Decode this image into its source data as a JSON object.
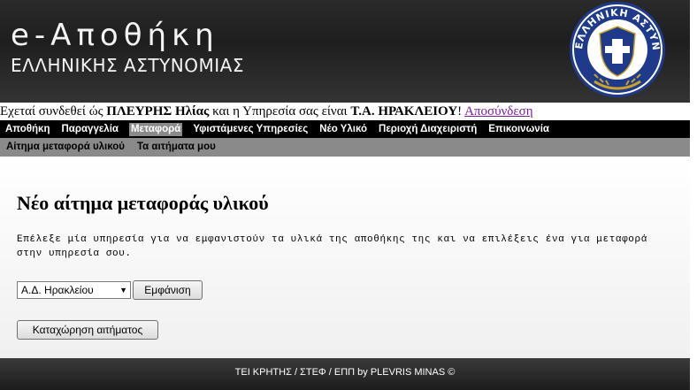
{
  "header": {
    "title": "e-Αποθήκη",
    "subtitle": "ΕΛΛΗΝΙΚΗΣ ΑΣΤΥΝΟΜΙΑΣ",
    "logo_text": "ΕΛΛΗΝΙΚΗ ΑΣΤΥΝΟΜΙΑ"
  },
  "login": {
    "prefix": "Εχεταί συνδεθεί ώς ",
    "user": "ΠΛΕΥΡΗΣ Ηλίας",
    "middle": " και η Υπηρεσία σας είναι ",
    "unit": "Τ.Α. ΗΡΑΚΛΕΙΟΥ",
    "suffix": "! ",
    "logout": "Αποσύνδεση"
  },
  "nav": {
    "items": [
      {
        "label": "Αποθήκη"
      },
      {
        "label": "Παραγγελία"
      },
      {
        "label": "Μεταφορά"
      },
      {
        "label": "Υφιστάμενες Υπηρεσίες"
      },
      {
        "label": "Νέο Υλικό"
      },
      {
        "label": "Περιοχή Διαχειριστή"
      },
      {
        "label": "Επικοινωνία"
      }
    ],
    "active_index": 2
  },
  "subnav": {
    "items": [
      {
        "label": "Αίτημα μεταφορά υλικού"
      },
      {
        "label": "Τα αιτήματα μου"
      }
    ]
  },
  "main": {
    "title": "Νέο αίτημα μεταφοράς υλικού",
    "instructions": "Επέλεξε μία υπηρεσία για να εμφανιστούν τα υλικά της αποθήκης της και να επιλέξεις ένα για μεταφορά στην υπηρεσία σου.",
    "select_value": "Α.Δ. Ηρακλείου",
    "show_button": "Εμφάνιση",
    "submit_button": "Καταχώρηση αιτήματος"
  },
  "footer": {
    "text": "ΤΕΙ ΚΡΗΤΗΣ / ΣΤΕΦ / ΕΠΠ by PLEVRIS MINAS ©"
  },
  "colors": {
    "header_bg": "#2a2a2a",
    "nav_bg": "#000000",
    "subnav_bg": "#8a8a8a",
    "logo_blue": "#1f3a8a",
    "link": "#7a1f9b"
  }
}
